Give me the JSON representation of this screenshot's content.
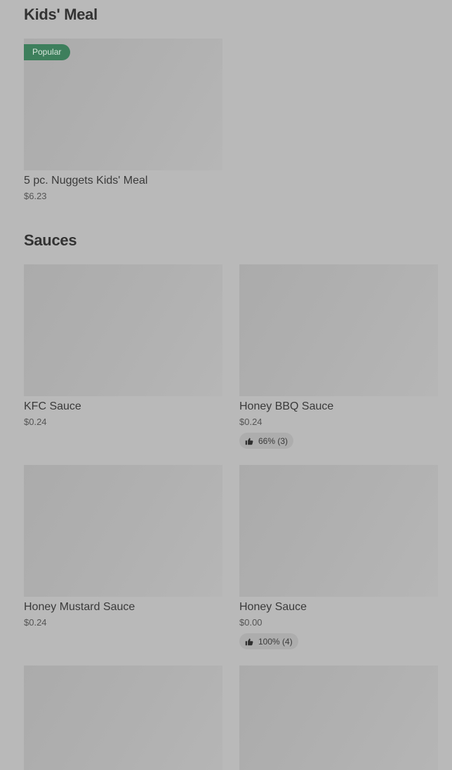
{
  "sections": {
    "kids_meal": {
      "title": "Kids' Meal",
      "items": [
        {
          "name": "5 pc. Nuggets Kids' Meal",
          "price": "$6.23",
          "badge": "Popular"
        }
      ]
    },
    "sauces": {
      "title": "Sauces",
      "items": [
        {
          "name": "KFC Sauce",
          "price": "$0.24"
        },
        {
          "name": "Honey BBQ Sauce",
          "price": "$0.24",
          "rating": "66% (3)"
        },
        {
          "name": "Honey Mustard Sauce",
          "price": "$0.24"
        },
        {
          "name": "Honey Sauce",
          "price": "$0.00",
          "rating": "100% (4)"
        }
      ]
    }
  },
  "colors": {
    "overlay_bg": "#b9b9b9",
    "badge_green": "#3d7f5c"
  },
  "icons": {
    "rating": "thumbs-up-icon"
  }
}
